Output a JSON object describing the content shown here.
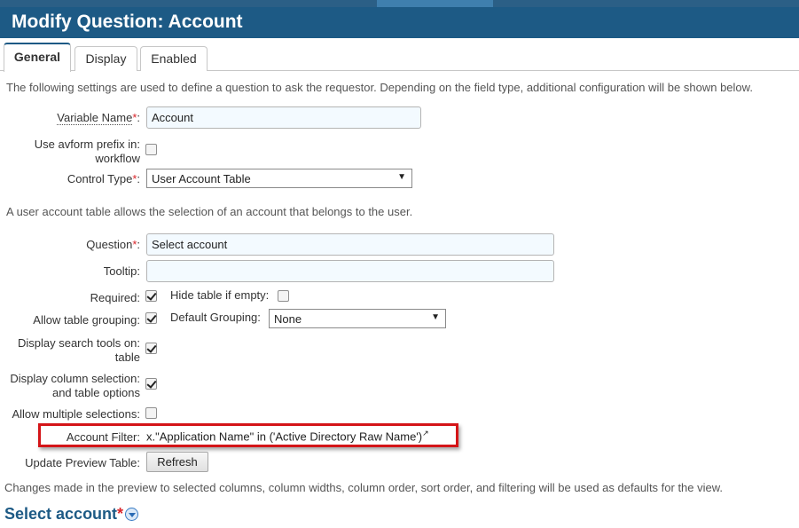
{
  "page": {
    "title": "Modify Question: Account"
  },
  "tabs": [
    {
      "label": "General",
      "active": true
    },
    {
      "label": "Display",
      "active": false
    },
    {
      "label": "Enabled",
      "active": false
    }
  ],
  "intro_text": "The following settings are used to define a question to ask the requestor. Depending on the field type, additional configuration will be shown below.",
  "fields": {
    "variable_name": {
      "label": "Variable Name",
      "required_mark": "*",
      "suffix": ":",
      "value": "Account"
    },
    "avform_prefix": {
      "label_line1": "Use avform prefix in:",
      "label_line2": "workflow",
      "checked": false
    },
    "control_type": {
      "label": "Control Type",
      "required_mark": "*",
      "suffix": ":",
      "value": "User Account Table"
    }
  },
  "control_description": "A user account table allows the selection of an account that belongs to the user.",
  "table_config": {
    "question": {
      "label": "Question",
      "required_mark": "*",
      "suffix": ":",
      "value": "Select account"
    },
    "tooltip": {
      "label": "Tooltip:",
      "value": ""
    },
    "required": {
      "label": "Required:",
      "checked": true
    },
    "hide_if_empty": {
      "label": "Hide table if empty:",
      "checked": false
    },
    "allow_grouping": {
      "label": "Allow table grouping:",
      "checked": true
    },
    "default_grouping": {
      "label": "Default Grouping:",
      "value": "None"
    },
    "search_tools": {
      "label_line1": "Display search tools on:",
      "label_line2": "table",
      "checked": true
    },
    "column_selection": {
      "label_line1": "Display column selection:",
      "label_line2": "and table options",
      "checked": true
    },
    "multiple_selections": {
      "label": "Allow multiple selections:",
      "checked": false
    },
    "account_filter": {
      "label": "Account Filter:",
      "value": "x.\"Application Name\" in ('Active Directory Raw Name')",
      "link_icon": "external-link-icon"
    },
    "update_preview": {
      "label": "Update Preview Table:",
      "button_label": "Refresh"
    }
  },
  "preview_note": "Changes made in the preview to selected columns, column widths, column order, sort order, and filtering will be used as defaults for the view.",
  "preview_section": {
    "title": "Select account",
    "required_mark": "*"
  },
  "colors": {
    "header_bg": "#1d5a85",
    "required": "#d9252a",
    "highlight_box": "#d41518",
    "input_bg": "#f3faff"
  }
}
